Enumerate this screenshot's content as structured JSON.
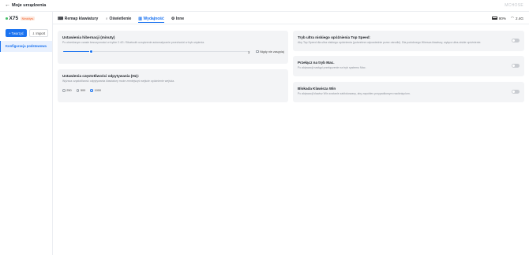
{
  "header": {
    "back_icon": "arrow-left-icon",
    "title": "Moje urządzenia",
    "brand": "MCHOSE"
  },
  "sidebar": {
    "device_name": "X75",
    "device_badge": "Nieaktyw.",
    "create_label": "Tworzyć",
    "import_label": "Import",
    "config_label": "Konfiguracja podstawowa"
  },
  "tabs": [
    {
      "label": "Remap klawiatury",
      "icon": "keyboard-icon",
      "active": false
    },
    {
      "label": "Oświetlenie",
      "icon": "bulb-icon",
      "active": false
    },
    {
      "label": "Wydajność",
      "icon": "performance-icon",
      "active": true
    },
    {
      "label": "Inne",
      "icon": "settings-icon",
      "active": false
    }
  ],
  "status": {
    "battery": "80%",
    "connection": "2.4G",
    "battery_icon": "battery-icon",
    "wifi_icon": "wifi-icon"
  },
  "hibernation": {
    "title": "Ustawienia hibernacji (minuty)",
    "desc": "Po określonym czasie bezczynności w trybie 2.4G / Bluetooth urządzenie automatycznie przechodzi w tryb uśpienia.",
    "value": "3",
    "value_fraction": 0.15,
    "never_label": "Nigdy nie zasypiaj",
    "never_checked": false
  },
  "polling": {
    "title": "Ustawienia częstotliwości odpytywania (Hz):",
    "desc": "Wyższa częstotliwość odpytywania klawiatury może zmniejszyć wejście opóźnienie wejścia.",
    "options": [
      "250",
      "500",
      "1000"
    ],
    "selected": "1000"
  },
  "top_speed": {
    "title": "Tryb ultra niskiego opóźnienia Top Speed:",
    "desc": "Aby Top Speed dla ultra niskiego opóźnienia (potrzebne odpowiednie przez ośrodki). Dla podobnego Wiersza klawiszy, wyłącz ultra-niskie opóźnienie.",
    "enabled": false
  },
  "mac_mode": {
    "title": "Przełącz na tryb Mac.",
    "desc": "Po aktywacji nastąpi przełączenie na tryb systemu Mac.",
    "enabled": false
  },
  "win_lock": {
    "title": "Blokada Klawisza Win",
    "desc": "Po aktywacji klawisz Win zostanie zablokowany, aby zapobiec przypadkowym naciśnięciom.",
    "enabled": false
  },
  "colors": {
    "accent": "#1b73f0",
    "card": "#f3f4f6",
    "badge": "#f26b3a"
  }
}
